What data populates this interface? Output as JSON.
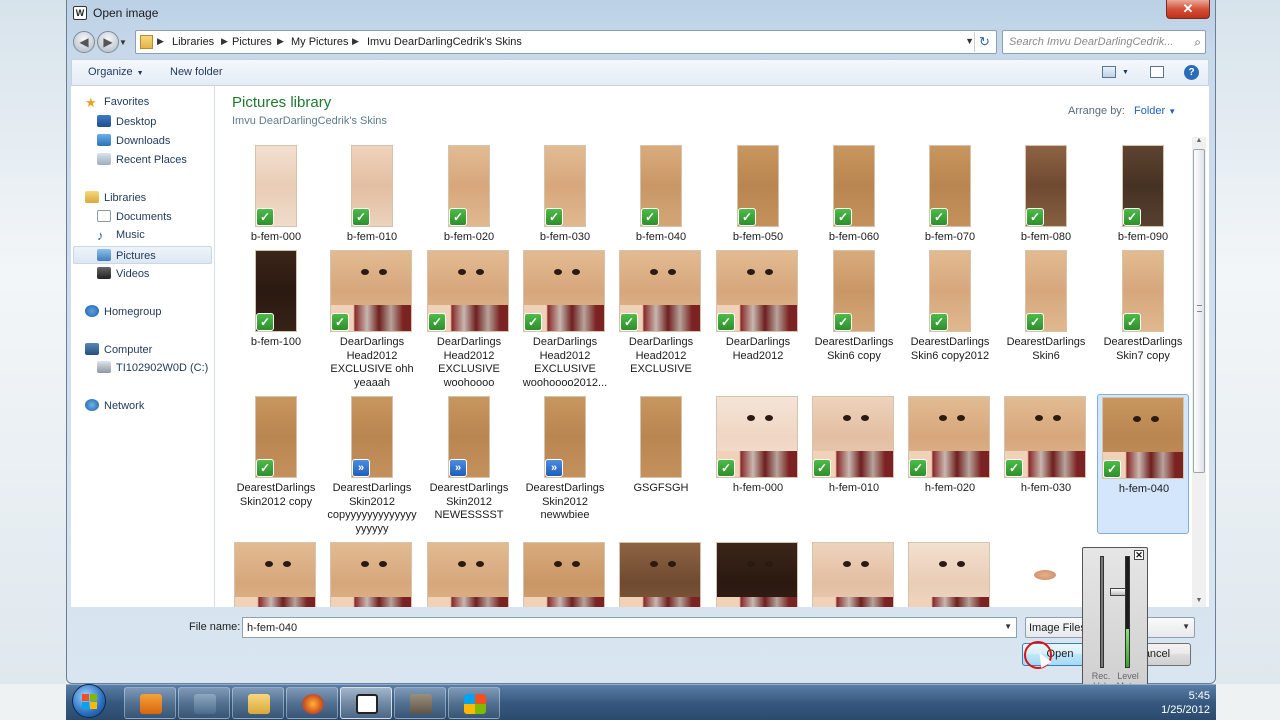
{
  "window": {
    "title": "Open image",
    "close_label": "✕"
  },
  "breadcrumb": [
    "Libraries",
    "Pictures",
    "My Pictures",
    "Imvu DearDarlingCedrik's Skins"
  ],
  "search": {
    "placeholder": "Search Imvu DearDarlingCedrik..."
  },
  "toolbar": {
    "organize_label": "Organize",
    "new_folder_label": "New folder"
  },
  "nav": {
    "items": [
      {
        "label": "Favorites",
        "icon": "star-icon"
      },
      {
        "label": "Desktop",
        "icon": "desktop-icon"
      },
      {
        "label": "Downloads",
        "icon": "downloads-icon"
      },
      {
        "label": "Recent Places",
        "icon": "recent-places-icon"
      },
      {
        "label": "Libraries",
        "icon": "libraries-icon"
      },
      {
        "label": "Documents",
        "icon": "documents-icon"
      },
      {
        "label": "Music",
        "icon": "music-icon"
      },
      {
        "label": "Pictures",
        "icon": "pictures-icon",
        "selected": true
      },
      {
        "label": "Videos",
        "icon": "videos-icon"
      },
      {
        "label": "Homegroup",
        "icon": "homegroup-icon"
      },
      {
        "label": "Computer",
        "icon": "computer-icon"
      },
      {
        "label": "TI102902W0D (C:)",
        "icon": "drive-icon"
      },
      {
        "label": "Network",
        "icon": "network-icon"
      }
    ]
  },
  "library": {
    "title": "Pictures library",
    "subtitle": "Imvu DearDarlingCedrik's Skins",
    "arrange_label": "Arrange by:",
    "arrange_value": "Folder"
  },
  "files": [
    {
      "name": "b-fem-000",
      "badge": "check"
    },
    {
      "name": "b-fem-010",
      "badge": "check"
    },
    {
      "name": "b-fem-020",
      "badge": "check"
    },
    {
      "name": "b-fem-030",
      "badge": "check"
    },
    {
      "name": "b-fem-040",
      "badge": "check"
    },
    {
      "name": "b-fem-050",
      "badge": "check"
    },
    {
      "name": "b-fem-060",
      "badge": "check"
    },
    {
      "name": "b-fem-070",
      "badge": "check"
    },
    {
      "name": "b-fem-080",
      "badge": "check"
    },
    {
      "name": "b-fem-090",
      "badge": "check"
    },
    {
      "name": "b-fem-100",
      "badge": "check"
    },
    {
      "name": "DearDarlings Head2012 EXCLUSIVE ohh yeaaah",
      "badge": "check"
    },
    {
      "name": "DearDarlings Head2012 EXCLUSIVE woohoooo",
      "badge": "check"
    },
    {
      "name": "DearDarlings Head2012 EXCLUSIVE woohoooo2012...",
      "badge": "check"
    },
    {
      "name": "DearDarlings Head2012 EXCLUSIVE",
      "badge": "check"
    },
    {
      "name": "DearDarlings Head2012",
      "badge": "check"
    },
    {
      "name": "DearestDarlings Skin6 copy",
      "badge": "check"
    },
    {
      "name": "DearestDarlings Skin6 copy2012",
      "badge": "check"
    },
    {
      "name": "DearestDarlings Skin6",
      "badge": "check"
    },
    {
      "name": "DearestDarlings Skin7 copy",
      "badge": "check"
    },
    {
      "name": "DearestDarlings Skin2012 copy",
      "badge": "check"
    },
    {
      "name": "DearestDarlings Skin2012 copyyyyyyyyyyyyy yyyyyy",
      "badge": "sync"
    },
    {
      "name": "DearestDarlings Skin2012 NEWESSSST",
      "badge": "sync"
    },
    {
      "name": "DearestDarlings Skin2012 newwbiee",
      "badge": "sync"
    },
    {
      "name": "GSGFSGH",
      "badge": ""
    },
    {
      "name": "h-fem-000",
      "badge": "check"
    },
    {
      "name": "h-fem-010",
      "badge": "check"
    },
    {
      "name": "h-fem-020",
      "badge": "check"
    },
    {
      "name": "h-fem-030",
      "badge": "check"
    },
    {
      "name": "h-fem-040",
      "badge": "check",
      "selected": true
    },
    {
      "name": "",
      "badge": ""
    },
    {
      "name": "",
      "badge": ""
    },
    {
      "name": "",
      "badge": ""
    },
    {
      "name": "",
      "badge": ""
    },
    {
      "name": "",
      "badge": ""
    },
    {
      "name": "",
      "badge": ""
    },
    {
      "name": "",
      "badge": ""
    },
    {
      "name": "",
      "badge": ""
    },
    {
      "name": "",
      "badge": ""
    },
    {
      "name": "",
      "badge": ""
    }
  ],
  "file_name": {
    "label": "File name:",
    "value": "h-fem-040"
  },
  "filter": {
    "value": "Image Files (*.gif; *"
  },
  "buttons": {
    "open_label": "Open",
    "cancel_label": "Cancel"
  },
  "meter": {
    "rec_vol_label": "Rec. Vol.",
    "level_meter_label": "Level Meter",
    "rec_vol_level": 0.7,
    "level_fraction": 0.35
  },
  "clock": {
    "time": "5:45",
    "date": "1/25/2012"
  },
  "colors": {
    "library_title": "#1e7a2d",
    "link_blue": "#1f63b5",
    "check_green": "#2e8f2b",
    "sync_blue": "#1f5fb8"
  }
}
